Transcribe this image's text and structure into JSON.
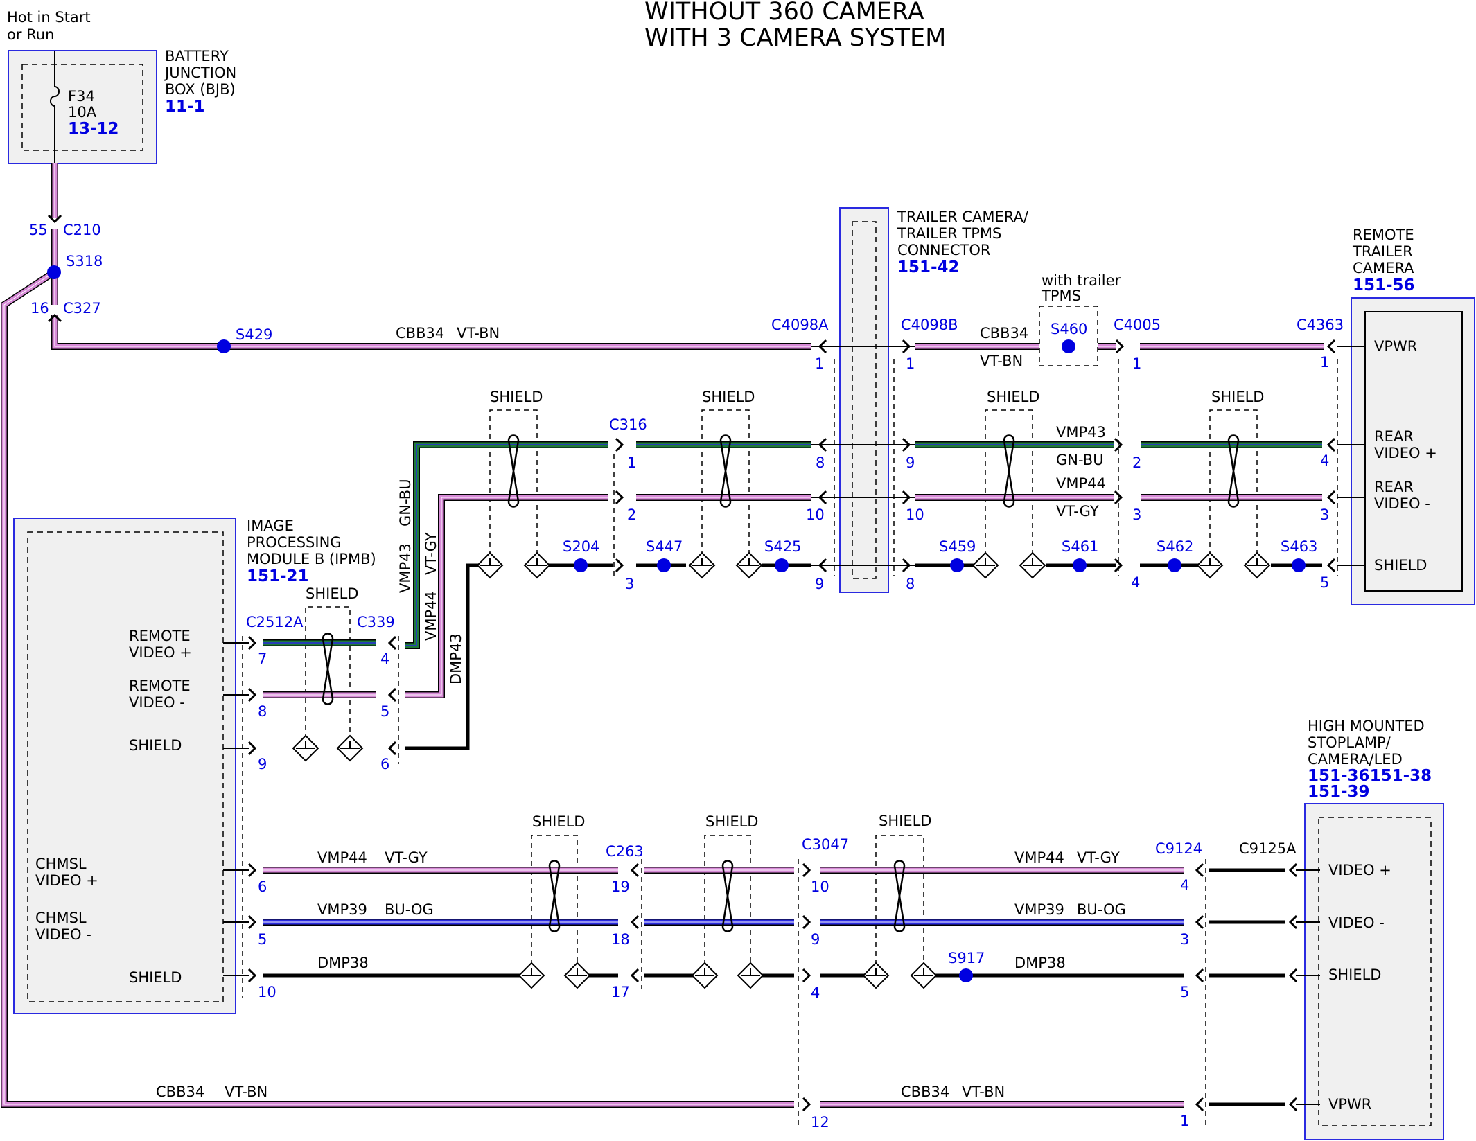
{
  "title": {
    "line1": "WITHOUT 360 CAMERA",
    "line2": "WITH 3 CAMERA SYSTEM"
  },
  "colors": {
    "vt_bn": "#d78ad7",
    "gn_bu": "#1e7a3a",
    "bu_og": "#2a2ae0",
    "vt_gy": "#d78ad7",
    "black": "#000000",
    "ref_blue": "#0000e0",
    "component_fill": "#f0f0f0"
  },
  "power": {
    "line1": "Hot in Start",
    "line2": "or Run"
  },
  "bjb": {
    "name1": "BATTERY",
    "name2": "JUNCTION",
    "name3": "BOX (BJB)",
    "ref": "11-1",
    "fuse": "F34",
    "amps": "10A",
    "fuse_ref": "13-12"
  },
  "ipmb": {
    "name1": "IMAGE",
    "name2": "PROCESSING",
    "name3": "MODULE B (IPMB)",
    "ref": "151-21",
    "pins": {
      "rv_plus1": "REMOTE",
      "rv_plus2": "VIDEO +",
      "rv_minus1": "REMOTE",
      "rv_minus2": "VIDEO -",
      "shield1": "SHIELD",
      "chm_plus1": "CHMSL",
      "chm_plus2": "VIDEO +",
      "chm_minus1": "CHMSL",
      "chm_minus2": "VIDEO -",
      "shield2": "SHIELD"
    }
  },
  "trailer_conn": {
    "name1": "TRAILER CAMERA/",
    "name2": "TRAILER TPMS",
    "name3": "CONNECTOR",
    "ref": "151-42"
  },
  "rtc": {
    "name1": "REMOTE",
    "name2": "TRAILER",
    "name3": "CAMERA",
    "ref": "151-56",
    "vpwr": "VPWR",
    "rv_plus1": "REAR",
    "rv_plus2": "VIDEO +",
    "rv_minus1": "REAR",
    "rv_minus2": "VIDEO -",
    "shield": "SHIELD"
  },
  "hmsl": {
    "name1": "HIGH MOUNTED",
    "name2": "STOPLAMP/",
    "name3": "CAMERA/LED",
    "ref1": "151-36151-38",
    "ref2": "151-39",
    "v_plus": "VIDEO +",
    "v_minus": "VIDEO -",
    "shield": "SHIELD",
    "vpwr": "VPWR"
  },
  "tpms_note": {
    "line1": "with trailer",
    "line2": "TPMS"
  },
  "connectors": {
    "c210": "C210",
    "c327": "C327",
    "c4098a": "C4098A",
    "c4098b": "C4098B",
    "c4005": "C4005",
    "c4363": "C4363",
    "c316": "C316",
    "c2512a": "C2512A",
    "c339": "C339",
    "c263": "C263",
    "c3047": "C3047",
    "c9124": "C9124",
    "c9125a": "C9125A"
  },
  "splices": {
    "s318": "S318",
    "s429": "S429",
    "s460": "S460",
    "s204": "S204",
    "s447": "S447",
    "s425": "S425",
    "s459": "S459",
    "s461": "S461",
    "s462": "S462",
    "s463": "S463",
    "s917": "S917"
  },
  "circuits": {
    "cbb34": "CBB34",
    "vt_bn": "VT-BN",
    "vmp43": "VMP43",
    "gn_bu": "GN-BU",
    "vmp44": "VMP44",
    "vt_gy": "VT-GY",
    "dmp43": "DMP43",
    "vmp39": "VMP39",
    "bu_og": "BU-OG",
    "dmp38": "DMP38",
    "shield": "SHIELD"
  },
  "pins": {
    "p55": "55",
    "p16": "16",
    "p1": "1",
    "p2": "2",
    "p3": "3",
    "p4": "4",
    "p5": "5",
    "p6": "6",
    "p7": "7",
    "p8": "8",
    "p9": "9",
    "p10": "10",
    "p12": "12",
    "p17": "17",
    "p18": "18",
    "p19": "19"
  }
}
